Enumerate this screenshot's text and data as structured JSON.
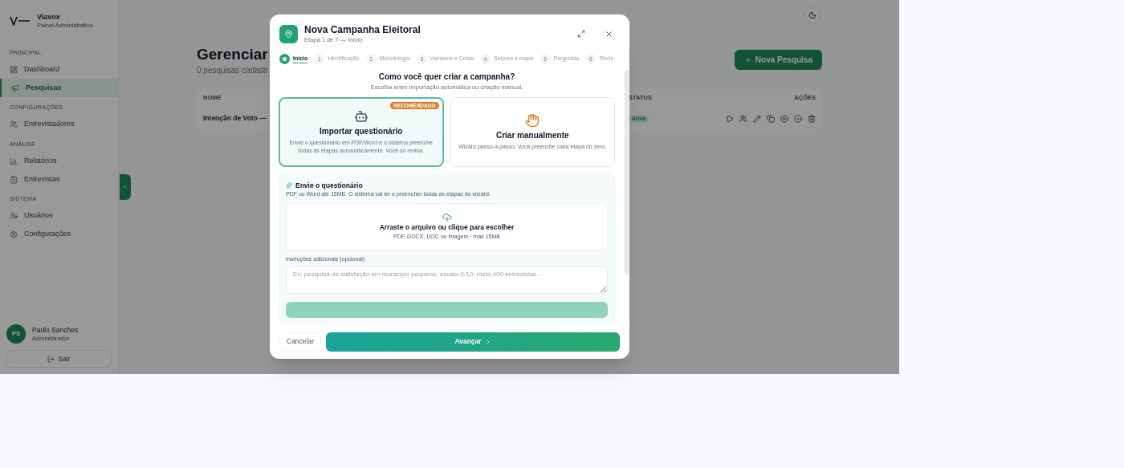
{
  "sidebar": {
    "brand": {
      "name": "Viavox",
      "subtitle": "Painel Administrativo"
    },
    "sections": [
      {
        "title": "PRINCIPAL",
        "items": [
          {
            "label": "Dashboard",
            "selected": false
          },
          {
            "label": "Pesquisas",
            "selected": true
          }
        ]
      },
      {
        "title": "CONFIGURAÇÕES",
        "items": [
          {
            "label": "Entrevistadores",
            "selected": false
          }
        ]
      },
      {
        "title": "ANÁLISE",
        "items": [
          {
            "label": "Relatórios",
            "selected": false
          },
          {
            "label": "Entrevistas",
            "selected": false
          }
        ]
      },
      {
        "title": "SISTEMA",
        "items": [
          {
            "label": "Usuários",
            "selected": false
          },
          {
            "label": "Configurações",
            "selected": false
          }
        ]
      }
    ],
    "user": {
      "initials": "PS",
      "name": "Paulo Sanches",
      "role": "Administrador"
    },
    "logout": "Sair"
  },
  "main": {
    "title": "Gerenciar",
    "subtitle": "0 pesquisas cadastr",
    "new_button": "Nova Pesquisa",
    "table": {
      "columns": [
        "NOME",
        "STATUS",
        "AÇÕES"
      ],
      "rows": [
        {
          "name": "Intenção de Voto —",
          "status": "Ativa"
        }
      ]
    }
  },
  "modal": {
    "title": "Nova Campanha Eleitoral",
    "subtitle": "Etapa 1 de 7 — Início",
    "steps": [
      {
        "label": "Início",
        "selected": true
      },
      {
        "number": "1",
        "label": "Identificação",
        "selected": false
      },
      {
        "number": "2",
        "label": "Metodologia",
        "selected": false
      },
      {
        "number": "3",
        "label": "Variáveis e Cotas",
        "selected": false
      },
      {
        "number": "4",
        "label": "Setores e mapa",
        "selected": false
      },
      {
        "number": "5",
        "label": "Perguntas",
        "selected": false
      },
      {
        "number": "6",
        "label": "Revis",
        "selected": false
      }
    ],
    "question": "Como você quer criar a campanha?",
    "question_hint": "Escolha entre importação automática ou criação manual.",
    "options": [
      {
        "kind": "robot",
        "title": "Importar questionário",
        "description": "Envie o questionário em PDF/Word e o sistema preenche todas as etapas automaticamente. Você só revisa.",
        "badge": "RECOMENDADO",
        "selected": true
      },
      {
        "kind": "hand",
        "title": "Criar manualmente",
        "description": "Wizard passo-a-passo. Você preenche cada etapa do zero.",
        "selected": false
      }
    ],
    "upload": {
      "title": "Envie o questionário",
      "description": "PDF ou Word até 15MB. O sistema vai ler e preencher todas as etapas do wizard.",
      "drop_title": "Arraste o arquivo ou clique para escolher",
      "drop_hint": "PDF, DOCX, DOC ou imagem · máx 15MB"
    },
    "instructions": {
      "label": "Instruções adicionais (opcional)",
      "placeholder": "Ex: pesquisa de satisfação em município pequeno, escala 0-10, meta 400 entrevistas..."
    },
    "cancel": "Cancelar",
    "next": "Avançar"
  }
}
